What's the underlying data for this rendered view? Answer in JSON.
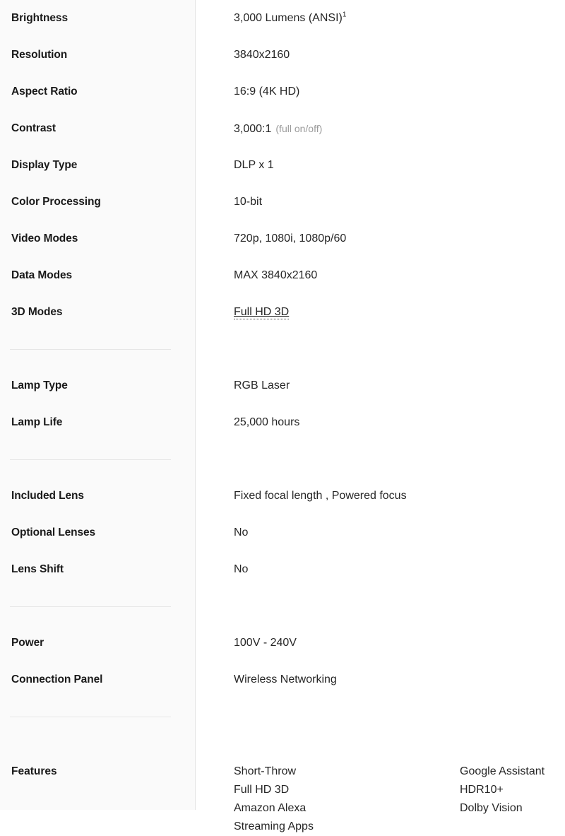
{
  "product_spec": {
    "sections": [
      {
        "id": "display",
        "rows": [
          {
            "label": "Brightness",
            "value": "3,000 Lumens (ANSI)",
            "superscript": "1"
          },
          {
            "label": "Resolution",
            "value": "3840x2160"
          },
          {
            "label": "Aspect Ratio",
            "value": "16:9 (4K HD)"
          },
          {
            "label": "Contrast",
            "value": "3,000:1",
            "note": "(full on/off)"
          },
          {
            "label": "Display Type",
            "value": "DLP x 1"
          },
          {
            "label": "Color Processing",
            "value": "10-bit"
          },
          {
            "label": "Video Modes",
            "value": "720p, 1080i, 1080p/60"
          },
          {
            "label": "Data Modes",
            "value": "MAX 3840x2160"
          },
          {
            "label": "3D Modes",
            "value": "Full HD 3D",
            "style": "tooltip-link"
          }
        ]
      },
      {
        "id": "lamp",
        "rows": [
          {
            "label": "Lamp Type",
            "value": "RGB Laser"
          },
          {
            "label": "Lamp Life",
            "value": "25,000 hours"
          }
        ]
      },
      {
        "id": "lens",
        "rows": [
          {
            "label": "Included Lens",
            "value": "Fixed focal length , Powered focus"
          },
          {
            "label": "Optional Lenses",
            "value": "No"
          },
          {
            "label": "Lens Shift",
            "value": "No"
          }
        ]
      },
      {
        "id": "connectivity",
        "rows": [
          {
            "label": "Power",
            "value": "100V - 240V"
          },
          {
            "label": "Connection Panel",
            "value": "Wireless Networking"
          }
        ]
      }
    ],
    "features": {
      "label": "Features",
      "column_1": [
        "Short-Throw",
        "Full HD 3D",
        "Amazon Alexa",
        "Streaming Apps"
      ],
      "column_2": [
        "Google Assistant",
        "HDR10+",
        "Dolby Vision"
      ]
    },
    "colors": {
      "label_column_background": "#fafafa",
      "column_divider": "#e4e4e4",
      "section_divider": "#e6e6e6",
      "text_primary": "#262626",
      "text_label": "#1a1a1a",
      "text_muted": "#9b9b9b"
    }
  }
}
